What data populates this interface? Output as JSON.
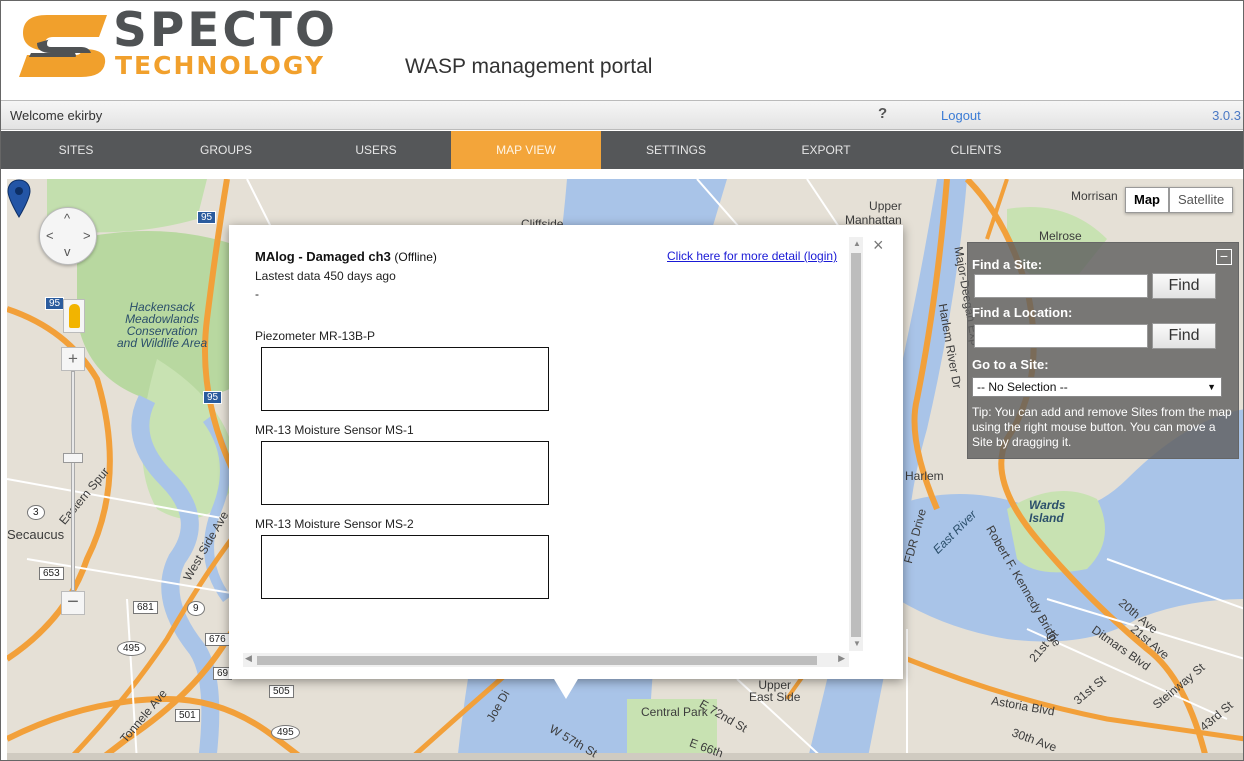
{
  "header": {
    "logo_word": "SPECTO",
    "logo_sub": "TECHNOLOGY",
    "portal_title": "WASP management portal",
    "brand_orange": "#f1a02c",
    "brand_grey": "#4f5254"
  },
  "welcome_bar": {
    "welcome": "Welcome ekirby",
    "help_icon": "question-mark-icon",
    "help_glyph": "?",
    "logout": "Logout",
    "version": "3.0.3"
  },
  "nav": {
    "tabs": [
      {
        "label": "SITES",
        "active": false
      },
      {
        "label": "GROUPS",
        "active": false
      },
      {
        "label": "USERS",
        "active": false
      },
      {
        "label": "MAP VIEW",
        "active": true
      },
      {
        "label": "SETTINGS",
        "active": false
      },
      {
        "label": "EXPORT",
        "active": false
      },
      {
        "label": "CLIENTS",
        "active": false
      }
    ],
    "active_color": "#f3a53a"
  },
  "map": {
    "type_buttons": {
      "map": "Map",
      "satellite": "Satellite"
    },
    "labels": {
      "cliffside": "Cliffside",
      "upper_manhattan": "Upper\nManhattan",
      "morrisania": "Morrisan",
      "melrose": "Melrose",
      "hackensack": "Hackensack\nMeadowlands\nConservation\nand Wildlife Area",
      "secaucus": "Secaucus",
      "wards_island": "Wards\nIsland",
      "harlem": "Harlem",
      "east_river": "East River",
      "central_park": "Central Park",
      "upper_east_side": "Upper\nEast Side",
      "astoria_blvd": "Astoria Blvd",
      "eastern_spur": "Eastern Spur",
      "west_side_ave": "West Side Ave",
      "fdr_drive": "FDR Drive",
      "rfk_bridge": "Robert F. Kennedy Bridge",
      "ditmars_blvd": "Ditmars Blvd",
      "steinway_st": "Steinway St",
      "harlem_river_dr": "Harlem River Dr",
      "major_deegan": "Major-Deegan Exp",
      "tonnele_ave": "Tonnele Ave",
      "joe_dimaggio": "Joe Di",
      "w_57th": "W 57th St",
      "e_72nd": "E 72nd St",
      "e_66th": "E 66th",
      "street_20th": "20th Ave",
      "street_21st": "21st Ave",
      "st_30th": "30th Ave",
      "st_31st": "31st St",
      "st_21": "21st St",
      "st_43rd": "43rd St"
    },
    "shields": [
      "95",
      "95",
      "95",
      "3",
      "653",
      "681",
      "9",
      "676",
      "495",
      "505",
      "501",
      "495",
      "69"
    ]
  },
  "find_panel": {
    "collapse_glyph": "−",
    "find_site_label": "Find a Site:",
    "find_site_value": "",
    "find_button_1": "Find",
    "find_location_label": "Find a Location:",
    "find_location_value": "",
    "find_button_2": "Find",
    "goto_label": "Go to a Site:",
    "goto_selected": "-- No Selection --",
    "tip": "Tip: You can add and remove Sites from the map using the right mouse button. You can move a Site by dragging it."
  },
  "info_window": {
    "title": "MAlog - Damaged ch3",
    "status": "(Offline)",
    "lastest": "Lastest data 450 days ago",
    "dash": "-",
    "detail_link": "Click here for more detail (login)",
    "close_glyph": "×",
    "sensors": [
      {
        "label": "Piezometer MR-13B-P"
      },
      {
        "label": "MR-13 Moisture Sensor MS-1"
      },
      {
        "label": "MR-13 Moisture Sensor MS-2"
      }
    ]
  }
}
